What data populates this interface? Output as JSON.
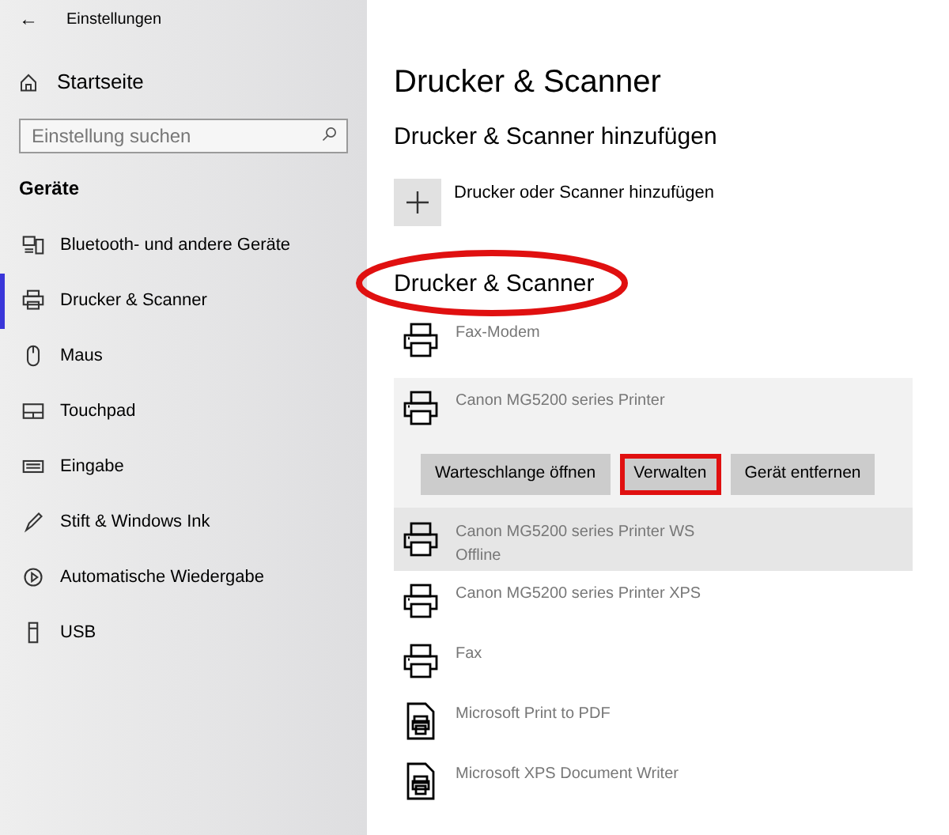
{
  "window": {
    "back": "←",
    "title": "Einstellungen"
  },
  "sidebar": {
    "home": "Startseite",
    "search": {
      "placeholder": "Einstellung suchen"
    },
    "group": "Geräte",
    "items": [
      {
        "label": "Bluetooth- und andere Geräte",
        "kind": "bluetooth",
        "selected": false
      },
      {
        "label": "Drucker & Scanner",
        "kind": "printer",
        "selected": true
      },
      {
        "label": "Maus",
        "kind": "mouse",
        "selected": false
      },
      {
        "label": "Touchpad",
        "kind": "touchpad",
        "selected": false
      },
      {
        "label": "Eingabe",
        "kind": "keyboard",
        "selected": false
      },
      {
        "label": "Stift & Windows Ink",
        "kind": "pen",
        "selected": false
      },
      {
        "label": "Automatische Wiedergabe",
        "kind": "autoplay",
        "selected": false
      },
      {
        "label": "USB",
        "kind": "usb",
        "selected": false
      }
    ]
  },
  "main": {
    "title": "Drucker & Scanner",
    "add_heading": "Drucker & Scanner hinzufügen",
    "add_label": "Drucker oder Scanner hinzufügen",
    "list_heading": "Drucker & Scanner",
    "list_heading_circled": true,
    "printers": [
      {
        "name": "Fax-Modem",
        "kind": "printer",
        "selected": false,
        "hovered": false
      },
      {
        "name": "Canon MG5200 series Printer",
        "kind": "printer",
        "selected": true,
        "hovered": false,
        "actions": [
          {
            "label": "Warteschlange öffnen",
            "highlighted": false
          },
          {
            "label": "Verwalten",
            "highlighted": true
          },
          {
            "label": "Gerät entfernen",
            "highlighted": false
          }
        ]
      },
      {
        "name": "Canon MG5200 series Printer WS",
        "status": "Offline",
        "kind": "printer",
        "selected": false,
        "hovered": true
      },
      {
        "name": "Canon MG5200 series Printer XPS",
        "kind": "printer",
        "selected": false,
        "hovered": false
      },
      {
        "name": "Fax",
        "kind": "printer",
        "selected": false,
        "hovered": false
      },
      {
        "name": "Microsoft Print to PDF",
        "kind": "document",
        "selected": false,
        "hovered": false
      },
      {
        "name": "Microsoft XPS Document Writer",
        "kind": "document",
        "selected": false,
        "hovered": false
      }
    ]
  }
}
